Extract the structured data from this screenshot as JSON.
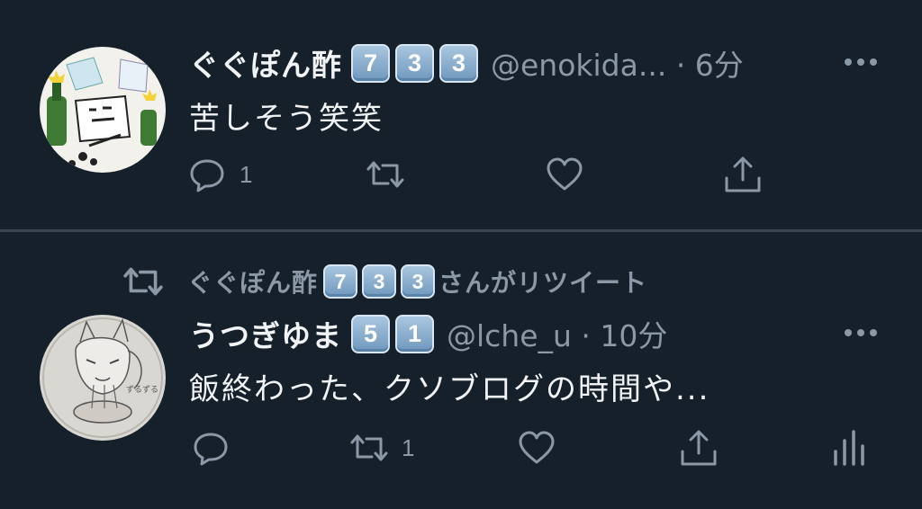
{
  "colors": {
    "background": "#15202b",
    "secondary_text": "#8b98a5",
    "primary_text": "#f1f3f5"
  },
  "tweets": [
    {
      "author_name": "ぐぐぽん酢",
      "badges": [
        "7",
        "3",
        "3"
      ],
      "handle_time": "@enokida... · 6分",
      "text": "苦しそう笑笑",
      "reply_count": "1",
      "retweet_count": "",
      "avatar_icon": "avatar-drawing"
    },
    {
      "retweeted_by_name": "ぐぐぽん酢",
      "retweeted_by_badges": [
        "7",
        "3",
        "3"
      ],
      "retweeted_suffix": "さんがリツイート",
      "author_name": "うつぎゆま",
      "badges": [
        "5",
        "1"
      ],
      "handle_time": "@lche_u · 10分",
      "text": "飯終わった、クソブログの時間や...",
      "reply_count": "",
      "retweet_count": "1",
      "avatar_icon": "avatar-sketch"
    }
  ]
}
